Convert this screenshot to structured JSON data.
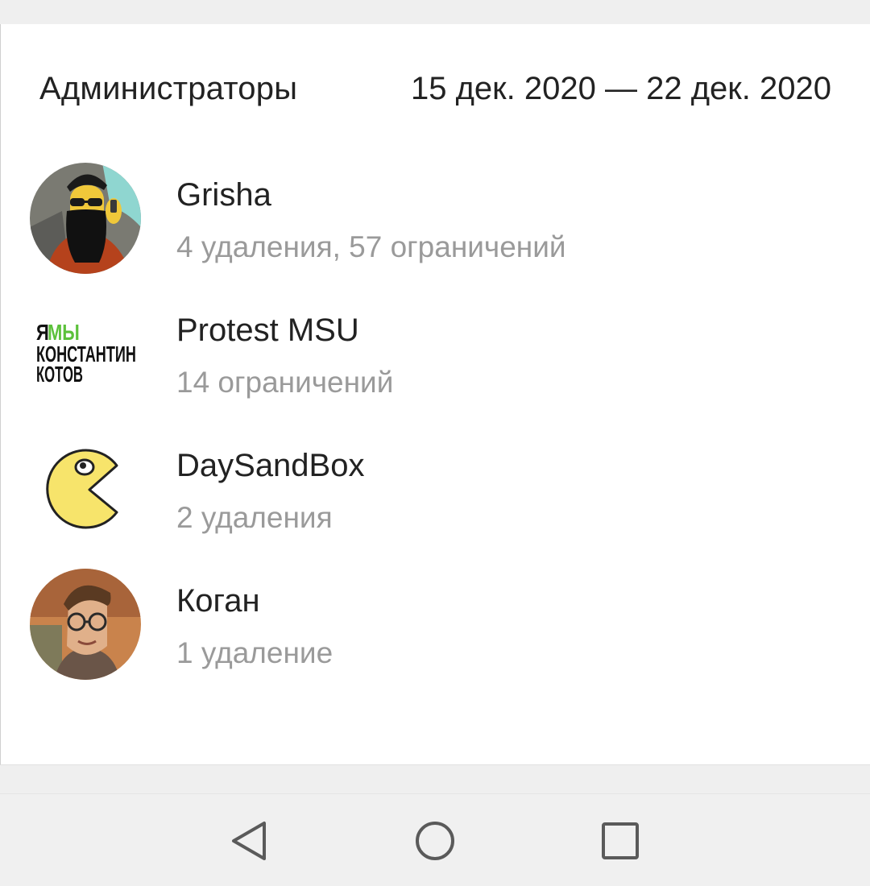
{
  "header": {
    "title": "Администраторы",
    "date_range": "15 дек. 2020 — 22 дек. 2020"
  },
  "admins": [
    {
      "name": "Grisha",
      "stats": "4 удаления, 57 ограничений",
      "avatar": "bearded-man-sunglasses-avatar"
    },
    {
      "name": "Protest MSU",
      "stats": "14 ограничений",
      "avatar": "text-logo-avatar",
      "logo_lines": [
        "ЯМЫ",
        "КОНСТАНТИН",
        "КОТОВ"
      ]
    },
    {
      "name": "DaySandBox",
      "stats": "2 удаления",
      "avatar": "pacman-avatar"
    },
    {
      "name": "Коган",
      "stats": "1 удаление",
      "avatar": "man-with-glasses-avatar"
    }
  ],
  "nav": {
    "back_icon": "triangle-back-icon",
    "home_icon": "circle-home-icon",
    "recents_icon": "square-recents-icon"
  },
  "colors": {
    "text_primary": "#222222",
    "text_secondary": "#9a9a9a",
    "logo_green": "#5cc13b",
    "pacman_yellow": "#f7e46b"
  }
}
